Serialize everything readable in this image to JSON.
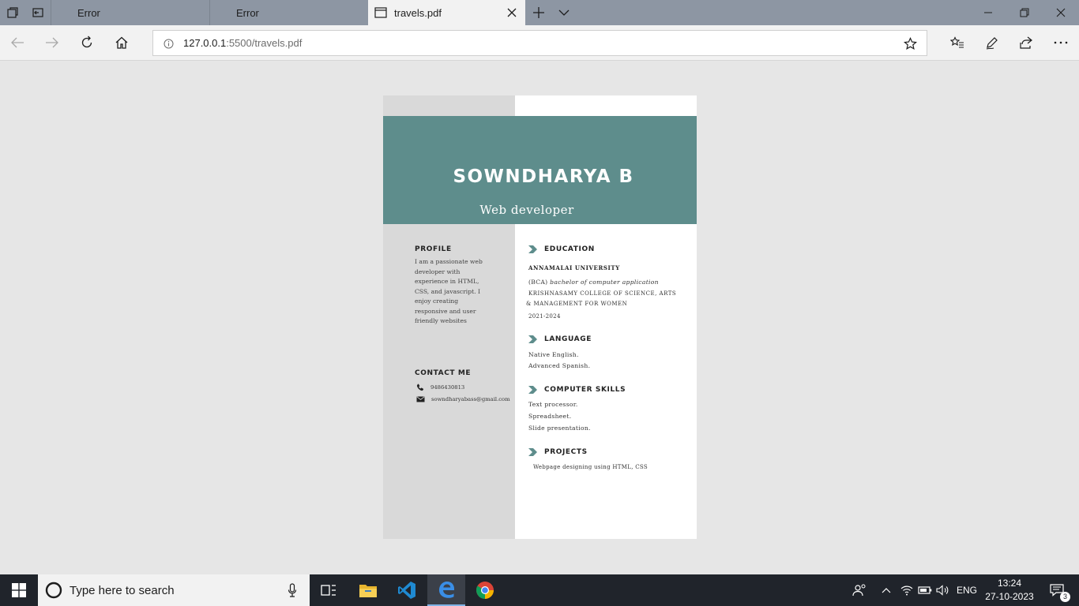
{
  "browser": {
    "tabs": [
      {
        "label": "Error",
        "active": false
      },
      {
        "label": "Error",
        "active": false
      },
      {
        "label": "travels.pdf",
        "active": true
      }
    ],
    "address": {
      "host": "127.0.0.1",
      "rest": ":5500/travels.pdf"
    }
  },
  "resume": {
    "name": "SOWNDHARYA B",
    "role": "Web developer",
    "profile": {
      "heading": "PROFILE",
      "lines": [
        "I am a passionate web",
        "developer with",
        "experience in HTML,",
        "CSS, and javascript. I",
        "enjoy creating",
        "responsive and user",
        "friendly websites"
      ]
    },
    "contact": {
      "heading": "CONTACT ME",
      "phone": "9486430813",
      "email": "sowndharyabass@gmail.com"
    },
    "education": {
      "heading": "EDUCATION",
      "university": "ANNAMALAI UNIVERSITY",
      "degree_prefix": "(BCA)",
      "degree": "bachelor of computer application",
      "college_line1": "KRISHNASAMY COLLEGE OF SCIENCE, ARTS",
      "college_line2": "& MANAGEMENT FOR WOMEN",
      "years": "2021-2024"
    },
    "language": {
      "heading": "LANGUAGE",
      "items": [
        "Native English.",
        "Advanced Spanish."
      ]
    },
    "skills": {
      "heading": "COMPUTER SKILLS",
      "items": [
        "Text processor.",
        "Spreadsheet.",
        "Slide presentation."
      ]
    },
    "projects": {
      "heading": "PROJECTS",
      "items": [
        "Webpage designing using HTML, CSS"
      ]
    },
    "accent_color": "#5e8d8c"
  },
  "taskbar": {
    "search_placeholder": "Type here to search",
    "language": "ENG",
    "time": "13:24",
    "date": "27-10-2023",
    "notification_count": "3"
  }
}
